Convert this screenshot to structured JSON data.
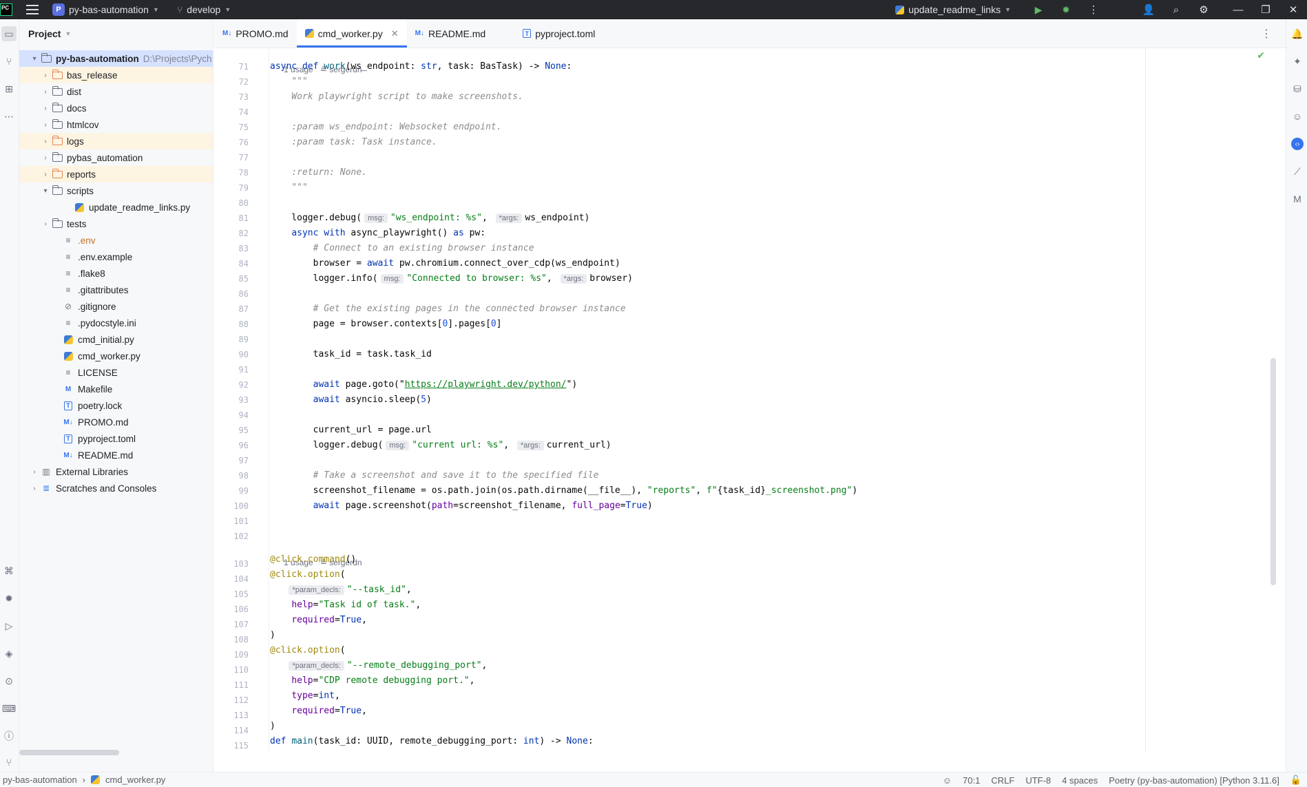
{
  "titlebar": {
    "project_badge": "P",
    "project_name": "py-bas-automation",
    "branch": "develop",
    "run_config": "update_readme_links"
  },
  "project_panel": {
    "title": "Project",
    "root": {
      "name": "py-bas-automation",
      "path": "D:\\Projects\\Pych"
    },
    "items": [
      {
        "label": "bas_release",
        "type": "folder-orange",
        "expandable": true,
        "indent": 1,
        "excluded": true
      },
      {
        "label": "dist",
        "type": "folder",
        "expandable": true,
        "indent": 1
      },
      {
        "label": "docs",
        "type": "folder",
        "expandable": true,
        "indent": 1
      },
      {
        "label": "htmlcov",
        "type": "folder",
        "expandable": true,
        "indent": 1
      },
      {
        "label": "logs",
        "type": "folder-orange",
        "expandable": true,
        "indent": 1,
        "excluded": true
      },
      {
        "label": "pybas_automation",
        "type": "folder",
        "expandable": true,
        "indent": 1
      },
      {
        "label": "reports",
        "type": "folder-orange",
        "expandable": true,
        "indent": 1,
        "excluded": true
      },
      {
        "label": "scripts",
        "type": "folder",
        "expandable": true,
        "expanded": true,
        "indent": 1
      },
      {
        "label": "update_readme_links.py",
        "type": "py",
        "indent": 3
      },
      {
        "label": "tests",
        "type": "folder",
        "expandable": true,
        "indent": 1
      },
      {
        "label": ".env",
        "type": "text-orange",
        "indent": 2
      },
      {
        "label": ".env.example",
        "type": "text",
        "indent": 2
      },
      {
        "label": ".flake8",
        "type": "text",
        "indent": 2
      },
      {
        "label": ".gitattributes",
        "type": "text",
        "indent": 2
      },
      {
        "label": ".gitignore",
        "type": "ignore",
        "indent": 2
      },
      {
        "label": ".pydocstyle.ini",
        "type": "text",
        "indent": 2
      },
      {
        "label": "cmd_initial.py",
        "type": "py",
        "indent": 2
      },
      {
        "label": "cmd_worker.py",
        "type": "py",
        "indent": 2
      },
      {
        "label": "LICENSE",
        "type": "text",
        "indent": 2
      },
      {
        "label": "Makefile",
        "type": "make",
        "indent": 2
      },
      {
        "label": "poetry.lock",
        "type": "toml",
        "indent": 2
      },
      {
        "label": "PROMO.md",
        "type": "md",
        "indent": 2
      },
      {
        "label": "pyproject.toml",
        "type": "toml",
        "indent": 2
      },
      {
        "label": "README.md",
        "type": "md",
        "indent": 2
      },
      {
        "label": "External Libraries",
        "type": "libs",
        "expandable": true,
        "indent": 0
      },
      {
        "label": "Scratches and Consoles",
        "type": "scratch",
        "expandable": true,
        "indent": 0
      }
    ]
  },
  "tabs": [
    {
      "label": "PROMO.md",
      "icon": "md"
    },
    {
      "label": "cmd_worker.py",
      "icon": "py",
      "active": true
    },
    {
      "label": "README.md",
      "icon": "md"
    },
    {
      "label": "pyproject.toml",
      "icon": "toml"
    }
  ],
  "editor": {
    "usage_hint_1": "1 usage",
    "author_1": "sergerdn",
    "usage_hint_2": "1 usage",
    "author_2": "sergerdn",
    "line_numbers": [
      "71",
      "72",
      "73",
      "74",
      "75",
      "76",
      "77",
      "78",
      "79",
      "80",
      "81",
      "82",
      "83",
      "84",
      "85",
      "86",
      "87",
      "88",
      "89",
      "90",
      "91",
      "92",
      "93",
      "94",
      "95",
      "96",
      "97",
      "98",
      "99",
      "100",
      "101",
      "102",
      "103",
      "104",
      "105",
      "106",
      "107",
      "108",
      "109",
      "110",
      "111",
      "112",
      "113",
      "114",
      "115"
    ],
    "hints": {
      "msg": "msg:",
      "args": "*args:",
      "param_decls": "*param_decls:"
    },
    "code": {
      "l71": [
        "async",
        "def",
        "work",
        "(ws_endpoint: ",
        "str",
        ", task: BasTask) -> ",
        "None",
        ":"
      ],
      "l72": "\"\"\"",
      "l73": "Work playwright script to make screenshots.",
      "l75": ":param ws_endpoint: Websocket endpoint.",
      "l76": ":param task: Task instance.",
      "l78": ":return: None.",
      "l79": "\"\"\"",
      "l81": {
        "pre": "logger.debug(",
        "s1": "\"ws_endpoint: %s\"",
        "mid": ", ",
        "post": "ws_endpoint)"
      },
      "l82": {
        "k1": "async",
        "k2": "with",
        "mid": " async_playwright() ",
        "k3": "as",
        "post": " pw:"
      },
      "l83": "# Connect to an existing browser instance",
      "l84": {
        "pre": "browser = ",
        "k": "await",
        "post": " pw.chromium.connect_over_cdp(ws_endpoint)"
      },
      "l85": {
        "pre": "logger.info(",
        "s1": "\"Connected to browser: %s\"",
        "mid": ", ",
        "post": "browser)"
      },
      "l87": "# Get the existing pages in the connected browser instance",
      "l88": {
        "pre": "page = browser.contexts[",
        "n1": "0",
        "mid": "].pages[",
        "n2": "0",
        "post": "]"
      },
      "l90": "task_id = task.task_id",
      "l92": {
        "k": "await",
        "pre": " page.goto(\"",
        "url": "https://playwright.dev/python/",
        "post": "\")"
      },
      "l93": {
        "k": "await",
        "pre": " asyncio.sleep(",
        "n": "5",
        "post": ")"
      },
      "l95": "current_url = page.url",
      "l96": {
        "pre": "logger.debug(",
        "s1": "\"current url: %s\"",
        "mid": ", ",
        "post": "current_url)"
      },
      "l98": "# Take a screenshot and save it to the specified file",
      "l99": {
        "pre": "screenshot_filename = os.path.join(os.path.dirname(__file__), ",
        "s1": "\"reports\"",
        "mid": ", ",
        "s2a": "f\"",
        "fv": "{task_id}",
        "s2b": "_screenshot.png\"",
        "post": ")"
      },
      "l100": {
        "k": "await",
        "pre": " page.screenshot(",
        "p1": "path",
        "mid": "=screenshot_filename, ",
        "p2": "full_page",
        "eq": "=",
        "k2": "True",
        "post": ")"
      },
      "l103": {
        "d": "@click.command",
        "post": "()"
      },
      "l104": {
        "d": "@click.option",
        "post": "("
      },
      "l105": {
        "s": "\"--task_id\"",
        "post": ","
      },
      "l106": {
        "p": "help",
        "eq": "=",
        "s": "\"Task id of task.\"",
        "post": ","
      },
      "l107": {
        "p": "required",
        "eq": "=",
        "k": "True",
        "post": ","
      },
      "l108": ")",
      "l109": {
        "d": "@click.option",
        "post": "("
      },
      "l110": {
        "s": "\"--remote_debugging_port\"",
        "post": ","
      },
      "l111": {
        "p": "help",
        "eq": "=",
        "s": "\"CDP remote debugging port.\"",
        "post": ","
      },
      "l112": {
        "p": "type",
        "eq": "=",
        "k": "int",
        "post": ","
      },
      "l113": {
        "p": "required",
        "eq": "=",
        "k": "True",
        "post": ","
      },
      "l114": ")",
      "l115": {
        "k": "def",
        "fn": "main",
        "pre": "(task_id: UUID, remote_debugging_port: ",
        "k2": "int",
        "mid": ") -> ",
        "k3": "None",
        "post": ":"
      }
    }
  },
  "statusbar": {
    "project": "py-bas-automation",
    "file": "cmd_worker.py",
    "position": "70:1",
    "line_sep": "CRLF",
    "encoding": "UTF-8",
    "indent": "4 spaces",
    "interpreter": "Poetry (py-bas-automation) [Python 3.11.6]"
  },
  "colors": {
    "accent": "#3574f0",
    "keyword": "#0033b3",
    "string": "#067d17",
    "comment": "#8c8c8c",
    "selection": "#d5e1ff",
    "excluded": "#fdf4e2"
  }
}
